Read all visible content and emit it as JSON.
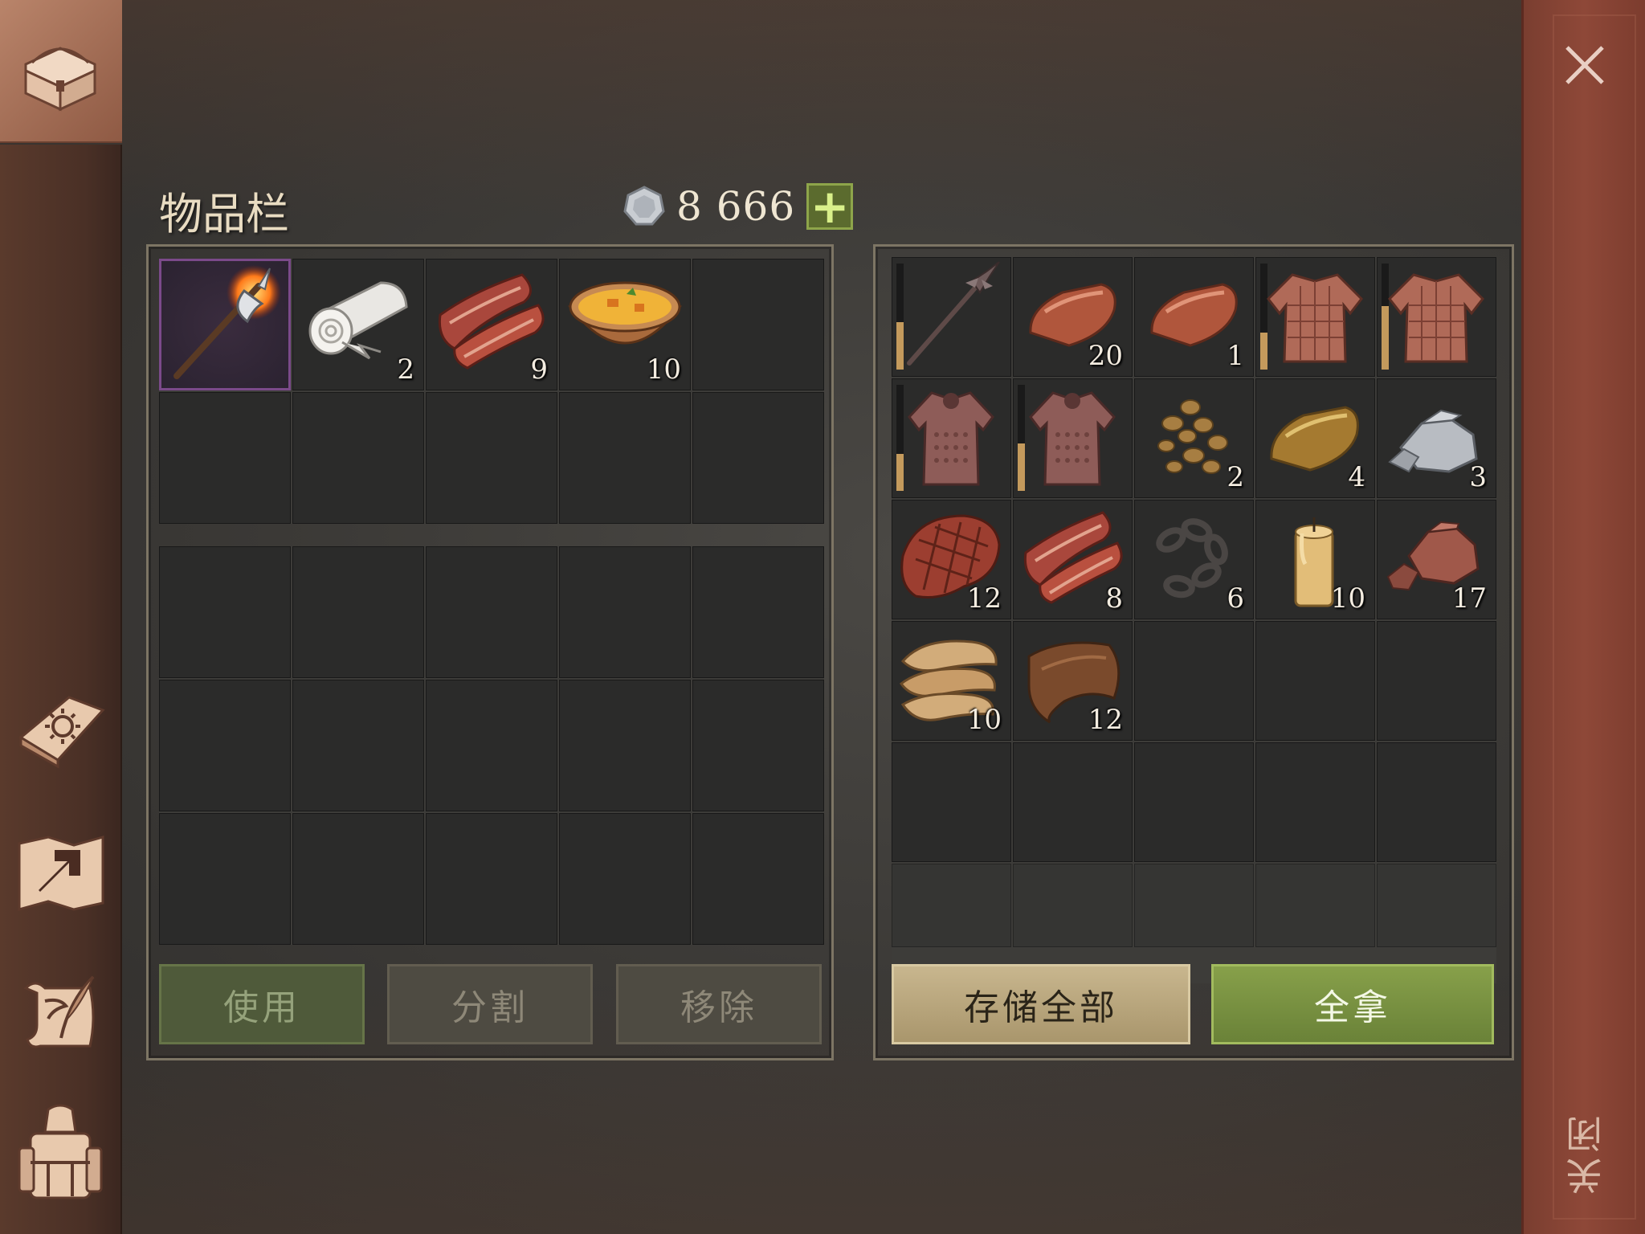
{
  "header": {
    "title": "物品栏",
    "currency": {
      "icon": "silver-coin-icon",
      "amount": "8 666",
      "add_label": "+"
    }
  },
  "close": {
    "x_label": "✕",
    "label": "关闭"
  },
  "sidebar": {
    "items": [
      {
        "icon": "chest-icon",
        "active": true
      },
      {
        "icon": "sun-book-icon"
      },
      {
        "icon": "map-arrow-icon"
      },
      {
        "icon": "scroll-quill-icon"
      },
      {
        "icon": "character-backpack-icon"
      }
    ]
  },
  "inventory": {
    "slots": [
      {
        "item": "flaming-halberd",
        "icon": "flaming-halberd-icon",
        "qty": "",
        "selected": true
      },
      {
        "item": "cloth-roll",
        "icon": "cloth-roll-icon",
        "qty": "2"
      },
      {
        "item": "raw-bacon",
        "icon": "bacon-icon",
        "qty": "9"
      },
      {
        "item": "stew-bowl",
        "icon": "stew-bowl-icon",
        "qty": "10"
      }
    ]
  },
  "storage": {
    "slots": [
      {
        "item": "spiked-mace",
        "icon": "spiked-mace-icon",
        "qty": "",
        "durability": 0.45
      },
      {
        "item": "copper-ingot",
        "icon": "copper-ingot-icon",
        "qty": "20"
      },
      {
        "item": "copper-ingot",
        "icon": "copper-ingot-icon",
        "qty": "1"
      },
      {
        "item": "padded-armor",
        "icon": "padded-armor-icon",
        "qty": "",
        "durability": 0.35
      },
      {
        "item": "padded-armor",
        "icon": "padded-armor-icon",
        "qty": "",
        "durability": 0.6
      },
      {
        "item": "chainmail",
        "icon": "chainmail-icon",
        "qty": "",
        "durability": 0.35
      },
      {
        "item": "chainmail",
        "icon": "chainmail-icon",
        "qty": "",
        "durability": 0.45
      },
      {
        "item": "pebbles",
        "icon": "pebbles-icon",
        "qty": "2"
      },
      {
        "item": "bronze-ingot",
        "icon": "bronze-ingot-icon",
        "qty": "4"
      },
      {
        "item": "iron-ore",
        "icon": "iron-ore-icon",
        "qty": "3"
      },
      {
        "item": "steak",
        "icon": "steak-icon",
        "qty": "12"
      },
      {
        "item": "raw-bacon",
        "icon": "bacon-icon",
        "qty": "8"
      },
      {
        "item": "iron-chain",
        "icon": "chain-icon",
        "qty": "6"
      },
      {
        "item": "candle",
        "icon": "candle-icon",
        "qty": "10"
      },
      {
        "item": "copper-ore",
        "icon": "copper-ore-icon",
        "qty": "17"
      },
      {
        "item": "leather",
        "icon": "leather-icon",
        "qty": "10"
      },
      {
        "item": "hide",
        "icon": "hide-icon",
        "qty": "12"
      }
    ]
  },
  "buttons": {
    "use": "使用",
    "split": "分割",
    "remove": "移除",
    "store_all": "存储全部",
    "take_all": "全拿"
  }
}
